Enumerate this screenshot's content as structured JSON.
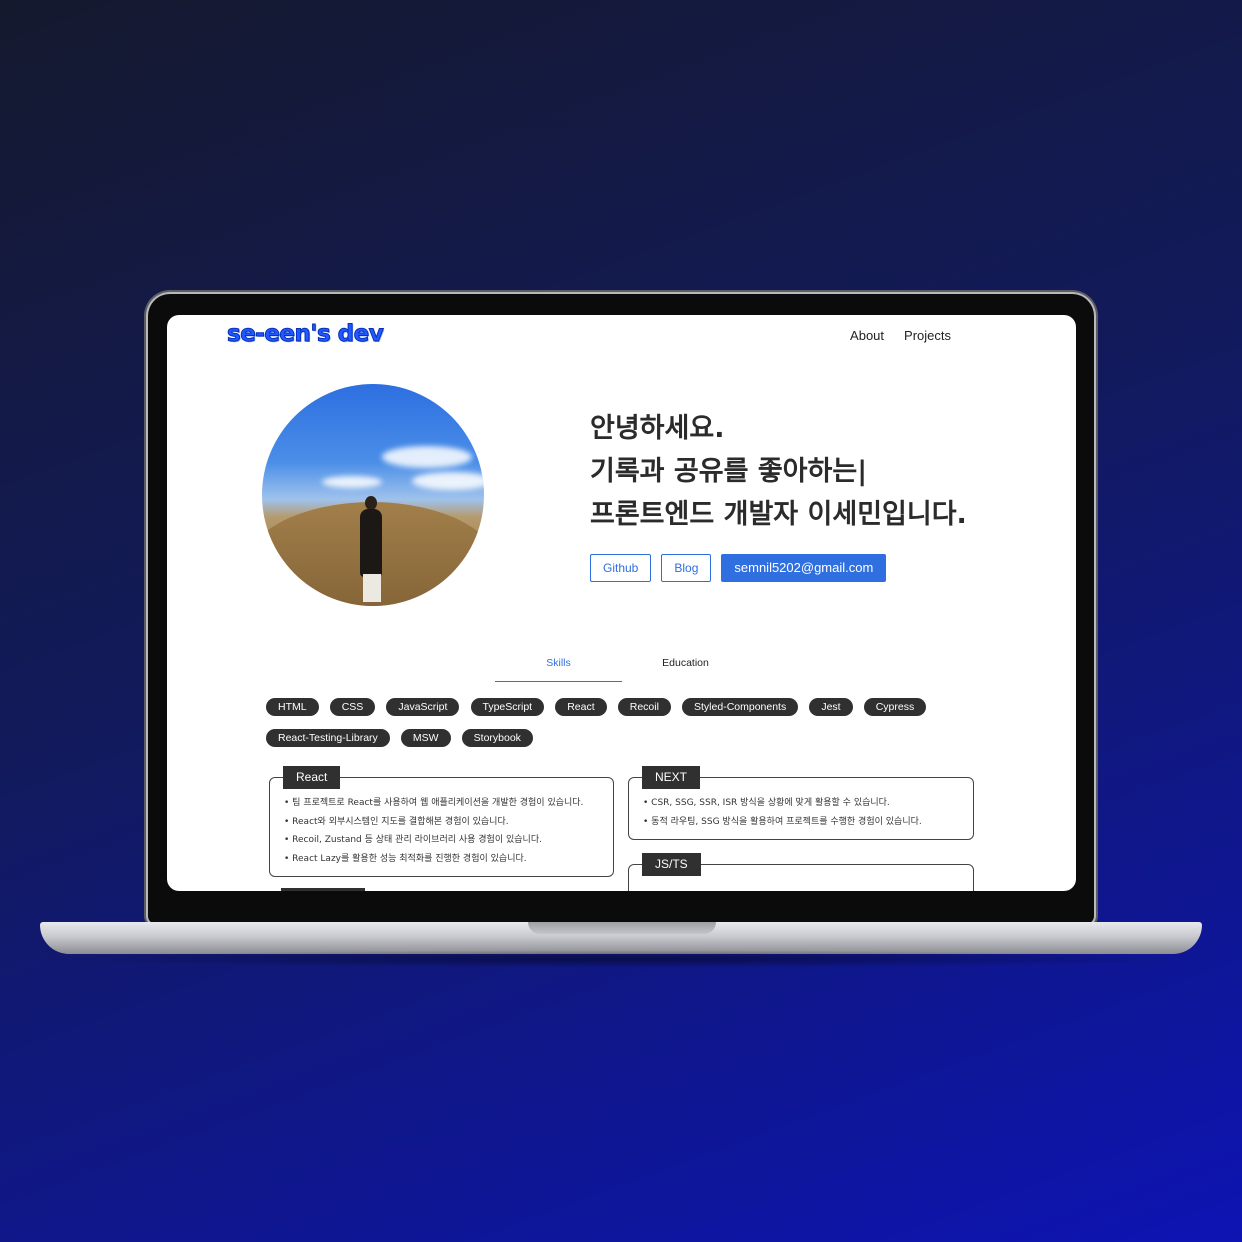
{
  "site": {
    "logo": "se-een's dev",
    "nav": [
      "About",
      "Projects"
    ]
  },
  "hero": {
    "lines": [
      "안녕하세요.",
      "기록과 공유를 좋아하는|",
      "프론트엔드 개발자 이세민입니다."
    ],
    "buttons": {
      "github": "Github",
      "blog": "Blog",
      "email": "semnil5202@gmail.com"
    }
  },
  "tabs": [
    "Skills",
    "Education"
  ],
  "skills": [
    "HTML",
    "CSS",
    "JavaScript",
    "TypeScript",
    "React",
    "Recoil",
    "Styled-Components",
    "Jest",
    "Cypress",
    "React-Testing-Library",
    "MSW",
    "Storybook"
  ],
  "cards": {
    "react": {
      "title": "React",
      "items": [
        "팀 프로젝트로 React를 사용하여 웹 애플리케이션을 개발한 경험이 있습니다.",
        "React와 외부시스템인 지도를 결합해본 경험이 있습니다.",
        "Recoil, Zustand 등 상태 관리 라이브러리 사용 경험이 있습니다.",
        "React Lazy를 활용한 성능 최적화를 진행한 경험이 있습니다."
      ]
    },
    "next": {
      "title": "NEXT",
      "items": [
        "CSR, SSG, SSR, ISR 방식을 상황에 맞게 활용할 수 있습니다.",
        "동적 라우팅, SSG 방식을 활용하여 프로젝트를 수행한 경험이 있습니다."
      ]
    },
    "jsts": {
      "title": "JS/TS"
    }
  },
  "colors": {
    "accent": "#2f6fe0",
    "chip": "#303030",
    "background_top": "#15192e",
    "background_bottom": "#0d14b3"
  }
}
